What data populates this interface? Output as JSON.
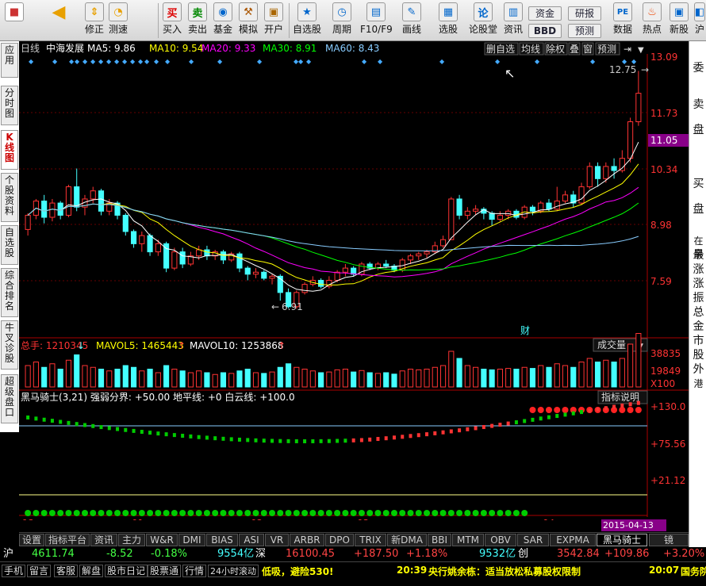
{
  "toolbar": {
    "items": [
      {
        "label": "",
        "icon": "home-icon"
      },
      {
        "label": "",
        "icon": "back-arrow-icon"
      },
      {
        "label": "修正",
        "icon": "up-down-arrows-icon"
      },
      {
        "label": "测速",
        "icon": "clock-icon"
      },
      {
        "label": "买入",
        "icon": "buy-icon"
      },
      {
        "label": "卖出",
        "icon": "sell-icon"
      },
      {
        "label": "基金",
        "icon": "fund-icon"
      },
      {
        "label": "模拟",
        "icon": "hammer-icon"
      },
      {
        "label": "开户",
        "icon": "lock-icon"
      },
      {
        "label": "自选股",
        "icon": "star-icon"
      },
      {
        "label": "周期",
        "icon": "period-clock-icon"
      },
      {
        "label": "F10/F9",
        "icon": "f10-icon"
      },
      {
        "label": "画线",
        "icon": "pencil-icon"
      },
      {
        "label": "选股",
        "icon": "screen-icon"
      },
      {
        "label": "论股堂",
        "icon": "forum-icon"
      },
      {
        "label": "资讯",
        "icon": "news-icon"
      },
      {
        "label": "数据",
        "icon": "pe-icon"
      },
      {
        "label": "热点",
        "icon": "flame-icon"
      },
      {
        "label": "新股",
        "icon": "new-stock-icon"
      },
      {
        "label": "沪",
        "icon": "sh-icon"
      }
    ],
    "fund_btn": "资金",
    "bbd_btn": "BBD",
    "research_btn": "研报",
    "forecast_btn": "预测",
    "pe_label": "PE"
  },
  "leftnav": [
    "应用",
    "分时图",
    "K线图",
    "个股资料",
    "自选股",
    "综合排名",
    "牛叉诊股",
    "超级盘口"
  ],
  "rightnav": [
    "委",
    "卖",
    "盘",
    "买",
    "盘",
    "在亲",
    "最",
    "涨",
    "涨",
    "振",
    "总",
    "金",
    "市",
    "股",
    "外",
    "港"
  ],
  "header": {
    "period": "日线",
    "stock": "中海发展",
    "ma5": "MA5: 9.86",
    "ma10": "MA10: 9.54",
    "ma20": "MA20: 9.33",
    "ma30": "MA30: 8.91",
    "ma60": "MA60: 8.43",
    "btns": [
      "删自选",
      "均线",
      "除权",
      "叠",
      "窗",
      "预测"
    ]
  },
  "price": {
    "ticks": [
      "13.09",
      "11.73",
      "10.34",
      "8.98",
      "7.59"
    ],
    "current": "11.05",
    "high": "12.75",
    "low": "6.91",
    "marker": "财"
  },
  "volume": {
    "total": "总手: 1210345",
    "mavol5": "MAVOL5: 1465443",
    "mavol10": "MAVOL10: 1253868",
    "dropdown": "成交量",
    "ticks": [
      "38835",
      "19849",
      "X100"
    ]
  },
  "indicator": {
    "title": "黑马骑士(3,21) 强弱分界: +50.00 地平线: +0 白云线: +100.0",
    "help": "指标说明",
    "ticks": [
      "+130.0",
      "+75.56",
      "+21.12"
    ]
  },
  "xaxis": {
    "labels": [
      "12",
      "01",
      "02",
      "03",
      "04"
    ],
    "date": "2015-04-13"
  },
  "tabs": [
    "设置",
    "指标平台",
    "资讯",
    "主力",
    "W&R",
    "DMI",
    "BIAS",
    "ASI",
    "VR",
    "ARBR",
    "DPO",
    "TRIX",
    "新DMA",
    "BBI",
    "MTM",
    "OBV",
    "SAR",
    "EXPMA",
    "黑马骑士",
    "镜"
  ],
  "quote": {
    "sh_label": "沪",
    "sh_index": "4611.74",
    "sh_chg": "-8.52",
    "sh_pct": "-0.18%",
    "sh_amt": "9554亿",
    "sz_label": "深",
    "sz_index": "16100.45",
    "sz_chg": "+187.50",
    "sz_pct": "+1.18%",
    "sz_amt": "9532亿",
    "cy_label": "创",
    "cy_index": "3542.84",
    "cy_chg": "+109.86",
    "cy_pct": "+3.20%"
  },
  "news": {
    "btns": [
      "手机",
      "留言",
      "客服",
      "解盘",
      "股市日记",
      "股票通",
      "行情",
      "24小时滚动"
    ],
    "ticker1": "低吸，避险530!",
    "time2": "20:39",
    "ticker2": "央行姚余栋：适当放松私募股权限制",
    "time3": "20:07",
    "ticker3": "国务院"
  },
  "chart_data": {
    "type": "candlestick",
    "candles": [
      [
        8.85,
        9.2,
        9.25,
        8.7
      ],
      [
        9.2,
        9.55,
        9.6,
        9.1
      ],
      [
        9.55,
        9.15,
        9.7,
        9.0
      ],
      [
        9.15,
        9.5,
        9.6,
        9.05
      ],
      [
        9.5,
        9.2,
        9.55,
        9.1
      ],
      [
        9.2,
        9.9,
        9.95,
        9.15
      ],
      [
        9.9,
        9.4,
        10.35,
        9.3
      ],
      [
        9.4,
        9.6,
        9.7,
        9.2
      ],
      [
        9.6,
        9.8,
        9.9,
        9.5
      ],
      [
        9.8,
        9.3,
        9.85,
        9.2
      ],
      [
        9.3,
        9.5,
        9.6,
        9.2
      ],
      [
        9.5,
        9.2,
        9.55,
        9.1
      ],
      [
        9.2,
        8.8,
        9.25,
        8.7
      ],
      [
        8.8,
        8.5,
        8.85,
        8.4
      ],
      [
        8.5,
        8.7,
        8.8,
        8.3
      ],
      [
        8.7,
        8.3,
        8.75,
        8.2
      ],
      [
        8.3,
        8.5,
        8.6,
        8.2
      ],
      [
        8.5,
        7.9,
        8.55,
        7.8
      ],
      [
        7.9,
        8.3,
        8.4,
        7.85
      ],
      [
        8.3,
        8.0,
        8.4,
        7.9
      ],
      [
        8.0,
        8.2,
        8.3,
        7.95
      ],
      [
        8.2,
        8.35,
        8.45,
        8.1
      ],
      [
        8.35,
        8.2,
        8.45,
        8.1
      ],
      [
        8.2,
        8.3,
        8.35,
        8.1
      ],
      [
        8.3,
        8.1,
        8.35,
        8.0
      ],
      [
        8.1,
        8.25,
        8.3,
        8.05
      ],
      [
        8.25,
        7.9,
        8.3,
        7.8
      ],
      [
        7.9,
        7.75,
        7.95,
        7.6
      ],
      [
        7.75,
        7.8,
        7.9,
        7.65
      ],
      [
        7.8,
        7.65,
        7.85,
        7.6
      ],
      [
        7.65,
        7.7,
        7.75,
        7.5
      ],
      [
        7.7,
        7.3,
        7.75,
        7.1
      ],
      [
        7.3,
        6.95,
        7.4,
        6.91
      ],
      [
        6.95,
        7.3,
        7.35,
        6.9
      ],
      [
        7.3,
        7.5,
        7.55,
        7.25
      ],
      [
        7.5,
        7.6,
        7.7,
        7.45
      ],
      [
        7.6,
        7.45,
        7.65,
        7.4
      ],
      [
        7.45,
        7.6,
        7.7,
        7.4
      ],
      [
        7.6,
        7.8,
        7.85,
        7.55
      ],
      [
        7.8,
        7.9,
        8.0,
        7.7
      ],
      [
        7.9,
        7.75,
        7.95,
        7.7
      ],
      [
        7.75,
        8.0,
        8.05,
        7.7
      ],
      [
        8.0,
        7.9,
        8.05,
        7.85
      ],
      [
        7.9,
        8.0,
        8.05,
        7.85
      ],
      [
        8.0,
        7.95,
        8.1,
        7.9
      ],
      [
        7.95,
        7.85,
        8.0,
        7.8
      ],
      [
        7.85,
        8.1,
        8.15,
        7.8
      ],
      [
        8.1,
        8.2,
        8.25,
        8.0
      ],
      [
        8.2,
        8.25,
        8.3,
        8.1
      ],
      [
        8.25,
        8.3,
        8.35,
        8.15
      ],
      [
        8.3,
        8.45,
        8.55,
        8.25
      ],
      [
        8.45,
        8.6,
        8.7,
        8.4
      ],
      [
        8.6,
        9.6,
        9.65,
        8.6
      ],
      [
        9.6,
        9.2,
        9.7,
        9.1
      ],
      [
        9.2,
        9.3,
        9.4,
        9.1
      ],
      [
        9.3,
        9.35,
        9.45,
        9.2
      ],
      [
        9.35,
        9.25,
        9.4,
        9.1
      ],
      [
        9.25,
        9.1,
        9.3,
        8.95
      ],
      [
        9.1,
        9.2,
        9.3,
        9.05
      ],
      [
        9.2,
        9.3,
        9.35,
        9.1
      ],
      [
        9.3,
        9.15,
        9.35,
        9.1
      ],
      [
        9.15,
        9.4,
        9.45,
        9.1
      ],
      [
        9.4,
        9.3,
        9.45,
        9.2
      ],
      [
        9.3,
        9.5,
        9.55,
        9.25
      ],
      [
        9.5,
        9.35,
        9.6,
        9.3
      ],
      [
        9.35,
        9.55,
        9.9,
        9.3
      ],
      [
        9.55,
        9.7,
        9.8,
        9.5
      ],
      [
        9.7,
        9.5,
        9.8,
        9.4
      ],
      [
        9.5,
        9.9,
        10.0,
        9.45
      ],
      [
        9.9,
        10.4,
        10.5,
        9.85
      ],
      [
        10.4,
        10.1,
        10.5,
        9.9
      ],
      [
        10.1,
        10.4,
        10.5,
        10.0
      ],
      [
        10.4,
        10.3,
        10.6,
        10.1
      ],
      [
        10.3,
        10.6,
        10.8,
        10.25
      ],
      [
        10.6,
        11.5,
        11.6,
        10.5
      ],
      [
        11.5,
        12.2,
        12.75,
        11.4
      ]
    ],
    "ma_lines": [
      "MA5",
      "MA10",
      "MA20",
      "MA30",
      "MA60"
    ],
    "price_axis": [
      13.09,
      11.73,
      10.34,
      8.98,
      7.59
    ],
    "volume_ratio": [
      0.6,
      0.7,
      0.55,
      0.65,
      0.5,
      0.75,
      0.9,
      0.6,
      0.55,
      0.5,
      0.45,
      0.5,
      0.6,
      0.55,
      0.45,
      0.5,
      0.4,
      0.6,
      0.5,
      0.45,
      0.4,
      0.45,
      0.4,
      0.35,
      0.4,
      0.38,
      0.45,
      0.5,
      0.4,
      0.38,
      0.42,
      0.55,
      0.65,
      0.55,
      0.5,
      0.45,
      0.4,
      0.42,
      0.48,
      0.5,
      0.42,
      0.46,
      0.4,
      0.38,
      0.4,
      0.36,
      0.45,
      0.5,
      0.48,
      0.5,
      0.55,
      0.6,
      1.0,
      0.8,
      0.6,
      0.55,
      0.5,
      0.48,
      0.5,
      0.52,
      0.5,
      0.55,
      0.52,
      0.6,
      0.55,
      0.65,
      0.6,
      0.55,
      0.7,
      0.8,
      0.7,
      0.75,
      0.7,
      0.8,
      1.2,
      1.5
    ]
  }
}
